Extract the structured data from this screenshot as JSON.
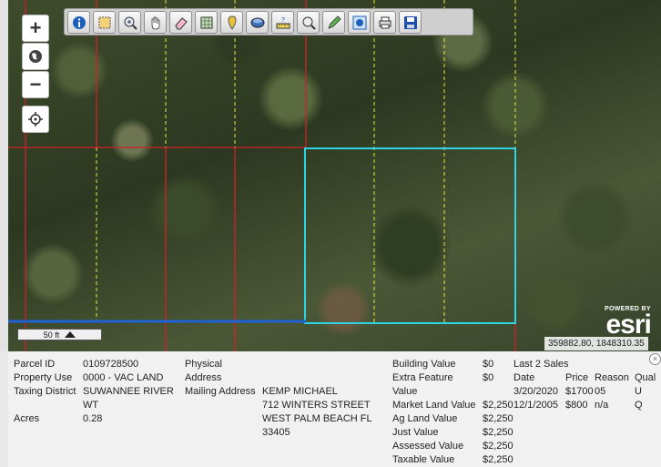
{
  "map": {
    "zoom_in": "+",
    "zoom_out": "−",
    "scale_label": "50 ft",
    "attribution_powered": "POWERED BY",
    "attribution_logo": "esri",
    "coordinates": "359882.80, 1848310.35",
    "parcel_line_color": "#d0202a",
    "selected_color": "#2fd3e6",
    "road_color": "#1e62d6"
  },
  "toolbar": {
    "tools": [
      "info-icon",
      "select-area-icon",
      "zoom-in-icon",
      "pan-hand-icon",
      "eraser-icon",
      "identify-grid-icon",
      "pin-icon",
      "layers-icon",
      "measure-icon",
      "magnifier-icon",
      "draw-pencil-icon",
      "buffer-icon",
      "print-icon",
      "save-icon"
    ]
  },
  "parcel": {
    "labels": {
      "parcel_id": "Parcel ID",
      "property_use": "Property Use",
      "taxing_district": "Taxing District",
      "acres": "Acres",
      "physical": "Physical",
      "address": "Address",
      "mailing_address": "Mailing Address",
      "building_value": "Building Value",
      "extra_feature": "Extra Feature",
      "value": "Value",
      "market_land_value": "Market Land Value",
      "ag_land_value": "Ag Land Value",
      "just_value": "Just Value",
      "assessed_value": "Assessed Value",
      "taxable_value": "Taxable Value"
    },
    "parcel_id": "0109728500",
    "property_use": "0000 - VAC LAND",
    "taxing_district_1": "SUWANNEE RIVER",
    "taxing_district_2": "WT",
    "acres": "0.28",
    "mailing_1": "KEMP MICHAEL",
    "mailing_2": "712 WINTERS STREET",
    "mailing_3": "WEST PALM BEACH FL",
    "mailing_4": "33405",
    "building_value": "$0",
    "extra_feature_value": "$0",
    "market_land_value": "$2,250",
    "ag_land_value": "$2,250",
    "just_value": "$2,250",
    "assessed_value": "$2,250",
    "taxable_value": "$2,250"
  },
  "sales": {
    "title": "Last 2 Sales",
    "headers": {
      "date": "Date",
      "price": "Price",
      "reason": "Reason",
      "qual": "Qual"
    },
    "rows": [
      {
        "date": "3/20/2020",
        "price": "$1700",
        "reason": "05",
        "qual": "U"
      },
      {
        "date": "12/1/2005",
        "price": "$800",
        "reason": "n/a",
        "qual": "Q"
      }
    ],
    "close": "×"
  }
}
